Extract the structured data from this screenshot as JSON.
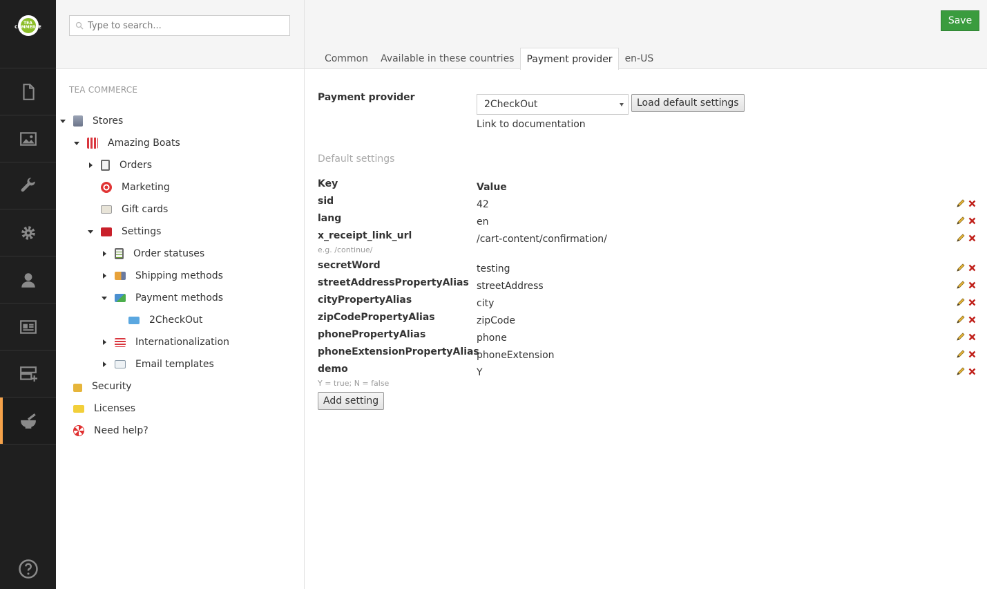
{
  "appbar": {
    "logo_text": "TEA COMMERCE",
    "sections": [
      "content",
      "media",
      "settings",
      "developer",
      "users",
      "members",
      "forms",
      "tea-commerce"
    ],
    "active_section": "tea-commerce"
  },
  "tree": {
    "search_placeholder": "Type to search...",
    "section_title": "TEA COMMERCE",
    "nodes": {
      "stores": "Stores",
      "amazing_boats": "Amazing Boats",
      "orders": "Orders",
      "marketing": "Marketing",
      "gift_cards": "Gift cards",
      "settings": "Settings",
      "order_statuses": "Order statuses",
      "shipping_methods": "Shipping methods",
      "payment_methods": "Payment methods",
      "twocheckout": "2CheckOut",
      "internationalization": "Internationalization",
      "email_templates": "Email templates",
      "security": "Security",
      "licenses": "Licenses",
      "need_help": "Need help?"
    }
  },
  "header": {
    "save_label": "Save",
    "tabs": [
      "Common",
      "Available in these countries",
      "Payment provider",
      "en-US"
    ],
    "active_tab": "Payment provider"
  },
  "form": {
    "provider_label": "Payment provider",
    "provider_value": "2CheckOut",
    "load_defaults_label": "Load default settings",
    "doc_link": "Link to documentation",
    "default_settings_heading": "Default settings",
    "key_header": "Key",
    "value_header": "Value",
    "add_setting_label": "Add setting",
    "settings": [
      {
        "key": "sid",
        "value": "42",
        "hint": ""
      },
      {
        "key": "lang",
        "value": "en",
        "hint": ""
      },
      {
        "key": "x_receipt_link_url",
        "value": "/cart-content/confirmation/",
        "hint": "e.g. /continue/"
      },
      {
        "key": "secretWord",
        "value": "testing",
        "hint": ""
      },
      {
        "key": "streetAddressPropertyAlias",
        "value": "streetAddress",
        "hint": ""
      },
      {
        "key": "cityPropertyAlias",
        "value": "city",
        "hint": ""
      },
      {
        "key": "zipCodePropertyAlias",
        "value": "zipCode",
        "hint": ""
      },
      {
        "key": "phonePropertyAlias",
        "value": "phone",
        "hint": ""
      },
      {
        "key": "phoneExtensionPropertyAlias",
        "value": "phoneExtension",
        "hint": ""
      },
      {
        "key": "demo",
        "value": "Y",
        "hint": "Y = true; N = false"
      }
    ]
  },
  "colors": {
    "appbar_bg": "#1f1f1f",
    "active_accent": "#f5a24a",
    "save_green": "#3a9c3e",
    "delete_red": "#c0201a"
  }
}
